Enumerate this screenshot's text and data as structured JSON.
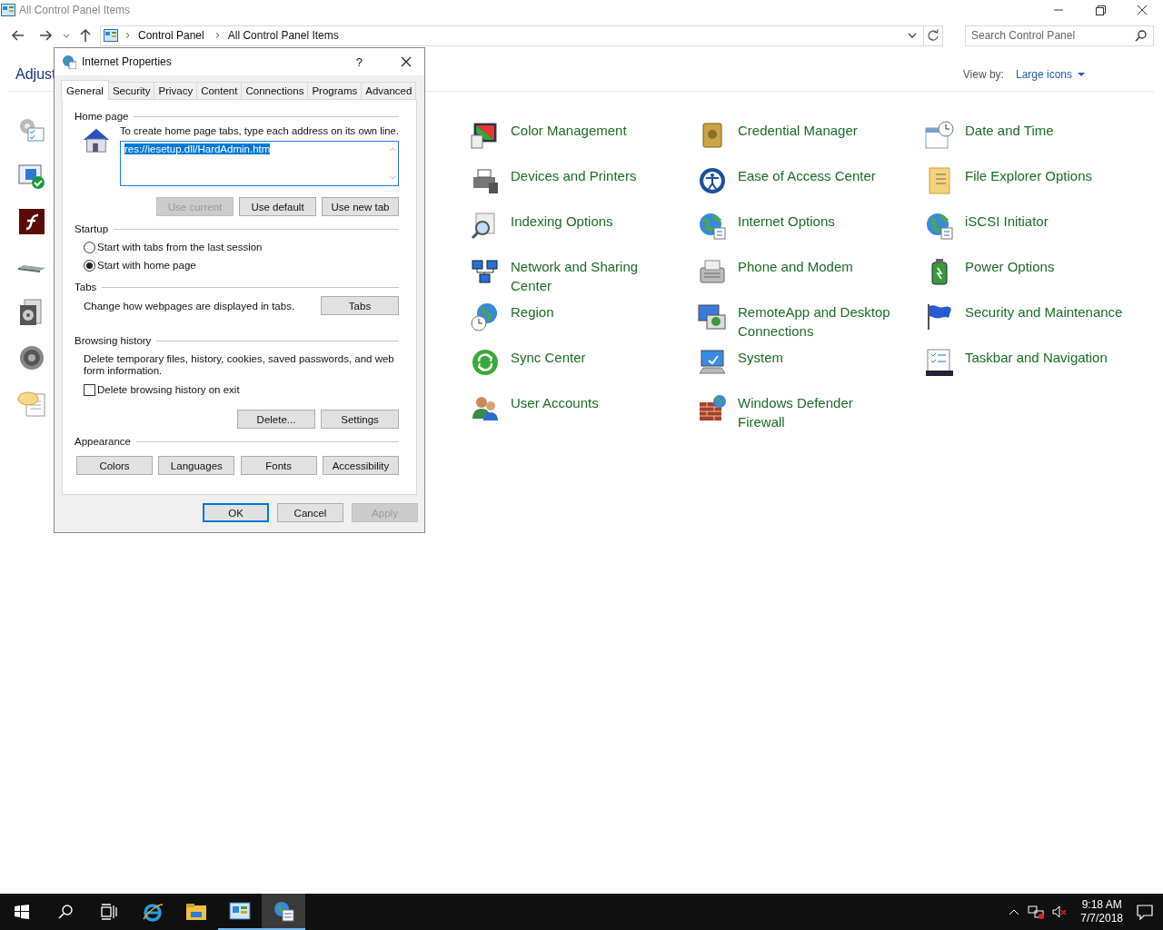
{
  "window": {
    "title": "All Control Panel Items"
  },
  "address": {
    "crumbs": [
      "Control Panel",
      "All Control Panel Items"
    ]
  },
  "search": {
    "placeholder": "Search Control Panel"
  },
  "heading": "Adjust",
  "view_by": {
    "label": "View by:",
    "value": "Large icons"
  },
  "items": [
    {
      "label": "Color Management",
      "kind": "color"
    },
    {
      "label": "Credential Manager",
      "kind": "vault"
    },
    {
      "label": "Date and Time",
      "kind": "clock"
    },
    {
      "label": "Devices and Printers",
      "kind": "printer"
    },
    {
      "label": "Ease of Access Center",
      "kind": "access"
    },
    {
      "label": "File Explorer Options",
      "kind": "folder"
    },
    {
      "label": "Indexing Options",
      "kind": "index"
    },
    {
      "label": "Internet Options",
      "kind": "globe"
    },
    {
      "label": "iSCSI Initiator",
      "kind": "globe"
    },
    {
      "label": "Network and Sharing\nCenter",
      "kind": "network"
    },
    {
      "label": "Phone and Modem",
      "kind": "phone"
    },
    {
      "label": "Power Options",
      "kind": "power"
    },
    {
      "label": "Region",
      "kind": "region"
    },
    {
      "label": "RemoteApp and Desktop\nConnections",
      "kind": "remote"
    },
    {
      "label": "Security and Maintenance",
      "kind": "flag"
    },
    {
      "label": "Sync Center",
      "kind": "sync"
    },
    {
      "label": "System",
      "kind": "system"
    },
    {
      "label": "Taskbar and Navigation",
      "kind": "taskbar"
    },
    {
      "label": "User Accounts",
      "kind": "users"
    },
    {
      "label": "Windows Defender\nFirewall",
      "kind": "firewall"
    }
  ],
  "dialog": {
    "title": "Internet Properties",
    "help": "?",
    "tabs": [
      {
        "label": "General",
        "selected": true
      },
      {
        "label": "Security",
        "selected": false
      },
      {
        "label": "Privacy",
        "selected": false
      },
      {
        "label": "Content",
        "selected": false
      },
      {
        "label": "Connections",
        "selected": false
      },
      {
        "label": "Programs",
        "selected": false
      },
      {
        "label": "Advanced",
        "selected": false
      }
    ],
    "home_page": {
      "title": "Home page",
      "hint": "To create home page tabs, type each address on its own line.",
      "value": "res://iesetup.dll/HardAdmin.htm",
      "buttons": [
        {
          "label": "Use current",
          "disabled": true
        },
        {
          "label": "Use default",
          "disabled": false
        },
        {
          "label": "Use new tab",
          "disabled": false
        }
      ]
    },
    "startup": {
      "title": "Startup",
      "options": [
        {
          "label": "Start with tabs from the last session",
          "selected": false
        },
        {
          "label": "Start with home page",
          "selected": true
        }
      ]
    },
    "tabs_section": {
      "title": "Tabs",
      "text": "Change how webpages are displayed in tabs.",
      "button": "Tabs"
    },
    "history": {
      "title": "Browsing history",
      "text": "Delete temporary files, history, cookies, saved passwords, and web form information.",
      "checkbox": {
        "label": "Delete browsing history on exit",
        "checked": false
      },
      "buttons": [
        {
          "label": "Delete...",
          "disabled": false
        },
        {
          "label": "Settings",
          "disabled": false
        }
      ]
    },
    "appearance": {
      "title": "Appearance",
      "buttons": [
        {
          "label": "Colors",
          "disabled": false
        },
        {
          "label": "Languages",
          "disabled": false
        },
        {
          "label": "Fonts",
          "disabled": false
        },
        {
          "label": "Accessibility",
          "disabled": false
        }
      ]
    },
    "footer_buttons": [
      {
        "label": "OK",
        "default": true,
        "disabled": false
      },
      {
        "label": "Cancel",
        "default": false,
        "disabled": false
      },
      {
        "label": "Apply",
        "default": false,
        "disabled": true
      }
    ]
  },
  "taskbar": {
    "apps": [
      {
        "kind": "ie",
        "running": false,
        "active": false
      },
      {
        "kind": "explorer",
        "running": false,
        "active": false
      },
      {
        "kind": "control",
        "running": true,
        "active": false
      },
      {
        "kind": "inetprops",
        "running": true,
        "active": true
      }
    ],
    "time": "9:18 AM",
    "date": "7/7/2018"
  }
}
